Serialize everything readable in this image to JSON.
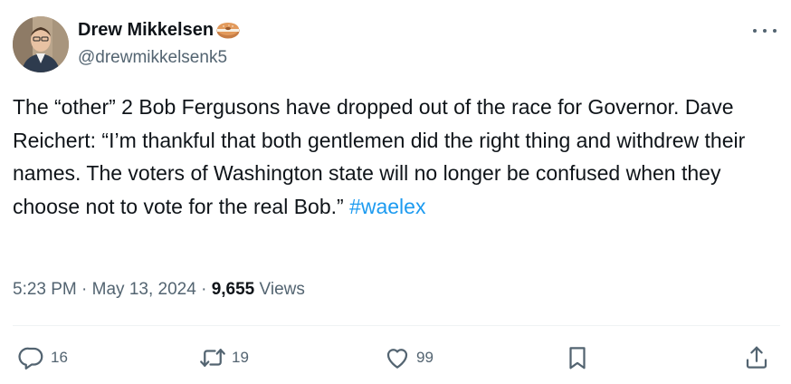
{
  "author": {
    "display_name": "Drew Mikkelsen",
    "name_emoji_icon": "bagel-icon",
    "handle": "@drewmikkelsenk5"
  },
  "tweet": {
    "text": "The “other” 2 Bob Fergusons have dropped out of the race for Governor. Dave Reichert: “I’m thankful that both gentlemen did the right thing and withdrew their names. The voters of Washington state will no longer be confused when they choose not to vote for the real Bob.” ",
    "hashtag": "#waelex"
  },
  "meta": {
    "time": "5:23 PM",
    "separator": " · ",
    "date": "May 13, 2024",
    "views_count": "9,655",
    "views_label": " Views"
  },
  "actions": {
    "reply_count": "16",
    "retweet_count": "19",
    "like_count": "99"
  },
  "colors": {
    "link": "#1d9bf0",
    "secondary_text": "#536471",
    "primary_text": "#0f1419",
    "divider": "#eff3f4"
  }
}
